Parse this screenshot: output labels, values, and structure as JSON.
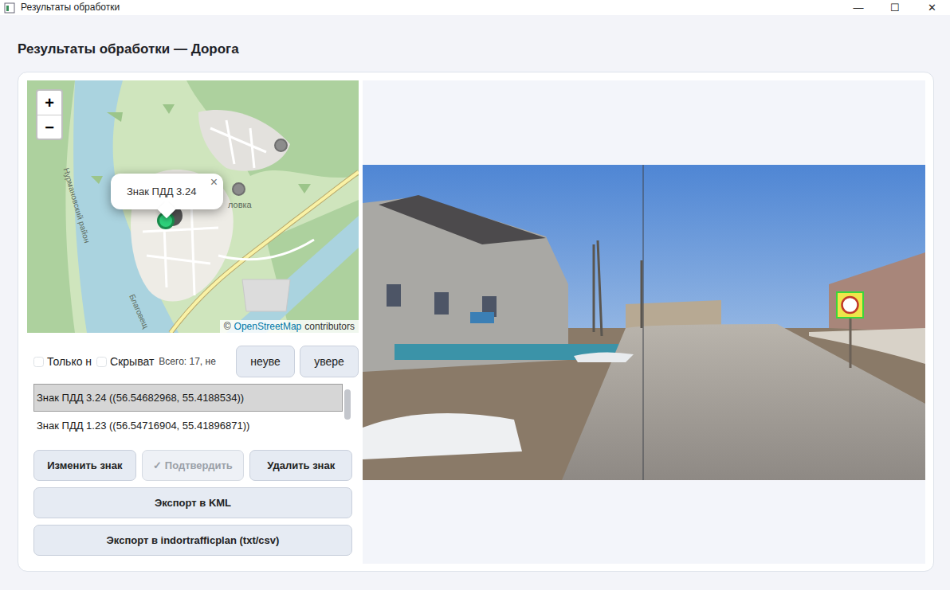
{
  "window": {
    "title": "Результаты обработки",
    "controls": [
      "—",
      "☐",
      "✕"
    ]
  },
  "heading": "Результаты обработки — Дорога",
  "map": {
    "zoom": [
      "+",
      "−"
    ],
    "popup": {
      "text": "Знак ПДД 3.24",
      "close": "×"
    },
    "pins": [
      {
        "selected": false
      },
      {
        "selected": false
      },
      {
        "selected": true
      }
    ],
    "labels": [
      {
        "text": "Нурмановский район"
      },
      {
        "text": "ловка"
      },
      {
        "text": "Благовещ"
      }
    ],
    "attribution": {
      "prefix": "©",
      "link": "OpenStreetMap",
      "suffix": "contributors"
    }
  },
  "filters": [
    {
      "label": "Только н",
      "checked": false
    },
    {
      "label": "Скрыват",
      "checked": false
    }
  ],
  "total": "Всего: 17, не",
  "filter_buttons": [
    "неуве",
    "увере"
  ],
  "signs": [
    {
      "label": "Знак ПДД 3.24 ((56.54682968, 55.4188534))",
      "selected": true
    },
    {
      "label": "Знак ПДД 1.23 ((56.54716904, 55.41896871))",
      "selected": false
    }
  ],
  "actions": [
    {
      "label": "Изменить знак",
      "disabled": false
    },
    {
      "label": "✓ Подтвердить",
      "disabled": true
    },
    {
      "label": "Удалить знак",
      "disabled": false
    }
  ],
  "exports": [
    "Экспорт в KML",
    "Экспорт в indortrafficplan (txt/csv)"
  ]
}
